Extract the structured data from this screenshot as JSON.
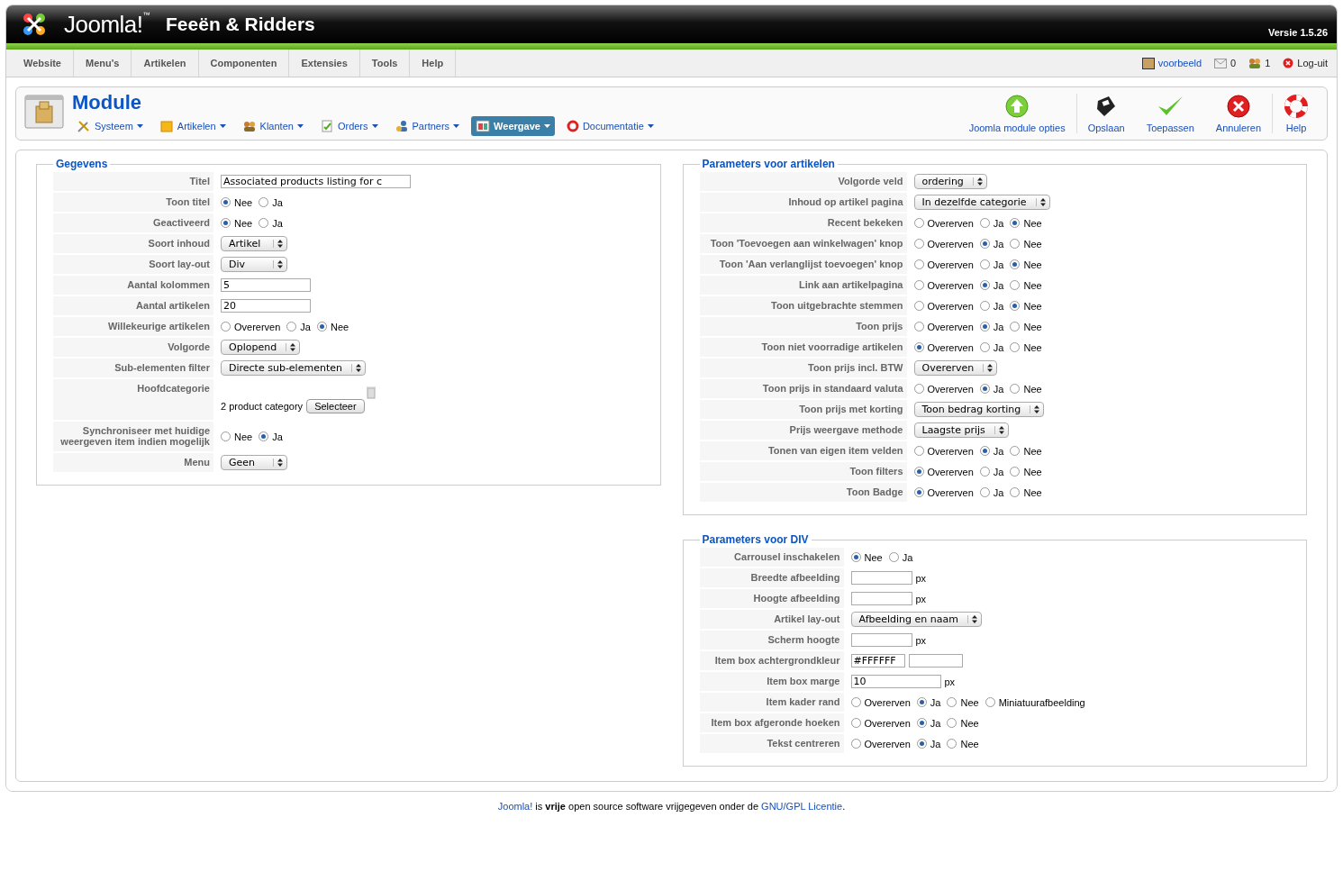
{
  "header": {
    "logo": "Joomla!$^{™}$",
    "site": "Feeën & Ridders",
    "version": "Versie 1.5.26"
  },
  "menu": [
    "Website",
    "Menu's",
    "Artikelen",
    "Componenten",
    "Extensies",
    "Tools",
    "Help"
  ],
  "status": [
    {
      "kind": "user",
      "label": "voorbeeld"
    },
    {
      "kind": "messages",
      "label": "0"
    },
    {
      "kind": "users",
      "label": "1"
    },
    {
      "kind": "logout",
      "label": "Log-uit"
    }
  ],
  "toolbar": {
    "title": "Module",
    "submenu": [
      {
        "label": "Systeem",
        "selected": false
      },
      {
        "label": "Artikelen",
        "selected": false
      },
      {
        "label": "Klanten",
        "selected": false
      },
      {
        "label": "Orders",
        "selected": false
      },
      {
        "label": "Partners",
        "selected": false
      },
      {
        "label": "Weergave",
        "selected": true
      },
      {
        "label": "Documentatie",
        "selected": false
      }
    ],
    "actions": [
      "Joomla module opties",
      "Opslaan",
      "Toepassen",
      "Annuleren",
      "Help"
    ]
  },
  "columns": [
    [
      {
        "title": "Gegevens",
        "rows": [
          {
            "kind": "text",
            "label": "Titel",
            "value": "Associated products listing for c"
          },
          {
            "kind": "radio",
            "label": "Toon titel",
            "options": [
              {
                "label": "Nee",
                "selected": true
              },
              {
                "label": "Ja",
                "selected": false
              }
            ]
          },
          {
            "kind": "radio",
            "label": "Geactiveerd",
            "options": [
              {
                "label": "Nee",
                "selected": true
              },
              {
                "label": "Ja",
                "selected": false
              }
            ]
          },
          {
            "kind": "select",
            "label": "Soort inhoud",
            "value": "Artikel"
          },
          {
            "kind": "select",
            "label": "Soort lay-out",
            "value": "Div"
          },
          {
            "kind": "text",
            "label": "Aantal kolommen",
            "value": "5"
          },
          {
            "kind": "text",
            "label": "Aantal artikelen",
            "value": "20"
          },
          {
            "kind": "radio",
            "label": "Willekeurige artikelen",
            "options": [
              {
                "label": "Overerven",
                "selected": false
              },
              {
                "label": "Ja",
                "selected": false
              },
              {
                "label": "Nee",
                "selected": true
              }
            ]
          },
          {
            "kind": "select",
            "label": "Volgorde",
            "value": "Oplopend"
          },
          {
            "kind": "select",
            "label": "Sub-elementen filter",
            "value": "Directe sub-elementen"
          },
          {
            "kind": "category",
            "label": "Hoofdcategorie",
            "value": "2 product category",
            "button": "Selecteer"
          },
          {
            "kind": "radio",
            "label": "Synchroniseer met huidige weergeven item indien mogelijk",
            "options": [
              {
                "label": "Nee",
                "selected": false
              },
              {
                "label": "Ja",
                "selected": true
              }
            ]
          },
          {
            "kind": "select",
            "label": "Menu",
            "value": "Geen"
          }
        ]
      }
    ],
    [
      {
        "title": "Parameters voor artikelen",
        "rows": [
          {
            "kind": "select",
            "label": "Volgorde veld",
            "value": "ordering"
          },
          {
            "kind": "select",
            "label": "Inhoud op artikel pagina",
            "value": "In dezelfde categorie"
          },
          {
            "kind": "radio",
            "label": "Recent bekeken",
            "options": [
              {
                "label": "Overerven",
                "selected": false
              },
              {
                "label": "Ja",
                "selected": false
              },
              {
                "label": "Nee",
                "selected": true
              }
            ]
          },
          {
            "kind": "radio",
            "label": "Toon 'Toevoegen aan winkelwagen' knop",
            "options": [
              {
                "label": "Overerven",
                "selected": false
              },
              {
                "label": "Ja",
                "selected": true
              },
              {
                "label": "Nee",
                "selected": false
              }
            ]
          },
          {
            "kind": "radio",
            "label": "Toon 'Aan verlanglijst toevoegen' knop",
            "options": [
              {
                "label": "Overerven",
                "selected": false
              },
              {
                "label": "Ja",
                "selected": false
              },
              {
                "label": "Nee",
                "selected": true
              }
            ]
          },
          {
            "kind": "radio",
            "label": "Link aan artikelpagina",
            "options": [
              {
                "label": "Overerven",
                "selected": false
              },
              {
                "label": "Ja",
                "selected": true
              },
              {
                "label": "Nee",
                "selected": false
              }
            ]
          },
          {
            "kind": "radio",
            "label": "Toon uitgebrachte stemmen",
            "options": [
              {
                "label": "Overerven",
                "selected": false
              },
              {
                "label": "Ja",
                "selected": false
              },
              {
                "label": "Nee",
                "selected": true
              }
            ]
          },
          {
            "kind": "radio",
            "label": "Toon prijs",
            "options": [
              {
                "label": "Overerven",
                "selected": false
              },
              {
                "label": "Ja",
                "selected": true
              },
              {
                "label": "Nee",
                "selected": false
              }
            ]
          },
          {
            "kind": "radio",
            "label": "Toon niet voorradige artikelen",
            "options": [
              {
                "label": "Overerven",
                "selected": true
              },
              {
                "label": "Ja",
                "selected": false
              },
              {
                "label": "Nee",
                "selected": false
              }
            ]
          },
          {
            "kind": "select",
            "label": "Toon prijs incl. BTW",
            "value": "Overerven"
          },
          {
            "kind": "radio",
            "label": "Toon prijs in standaard valuta",
            "options": [
              {
                "label": "Overerven",
                "selected": false
              },
              {
                "label": "Ja",
                "selected": true
              },
              {
                "label": "Nee",
                "selected": false
              }
            ]
          },
          {
            "kind": "select",
            "label": "Toon prijs met korting",
            "value": "Toon bedrag korting"
          },
          {
            "kind": "select",
            "label": "Prijs weergave methode",
            "value": "Laagste prijs"
          },
          {
            "kind": "radio",
            "label": "Tonen van eigen item velden",
            "options": [
              {
                "label": "Overerven",
                "selected": false
              },
              {
                "label": "Ja",
                "selected": true
              },
              {
                "label": "Nee",
                "selected": false
              }
            ]
          },
          {
            "kind": "radio",
            "label": "Toon filters",
            "options": [
              {
                "label": "Overerven",
                "selected": true
              },
              {
                "label": "Ja",
                "selected": false
              },
              {
                "label": "Nee",
                "selected": false
              }
            ]
          },
          {
            "kind": "radio",
            "label": "Toon Badge",
            "options": [
              {
                "label": "Overerven",
                "selected": true
              },
              {
                "label": "Ja",
                "selected": false
              },
              {
                "label": "Nee",
                "selected": false
              }
            ]
          }
        ]
      },
      {
        "title": "Parameters voor DIV",
        "rows": [
          {
            "kind": "radio",
            "label": "Carrousel inschakelen",
            "options": [
              {
                "label": "Nee",
                "selected": true
              },
              {
                "label": "Ja",
                "selected": false
              }
            ]
          },
          {
            "kind": "unit",
            "label": "Breedte afbeelding",
            "unit": "px"
          },
          {
            "kind": "unit",
            "label": "Hoogte afbeelding",
            "unit": "px"
          },
          {
            "kind": "select",
            "label": "Artikel lay-out",
            "value": "Afbeelding en naam"
          },
          {
            "kind": "unit",
            "label": "Scherm hoogte",
            "unit": "px"
          },
          {
            "kind": "color",
            "label": "Item box achtergrondkleur",
            "value": "#FFFFFF"
          },
          {
            "kind": "unit",
            "label": "Item box marge",
            "value": "10",
            "unit": "px"
          },
          {
            "kind": "radio",
            "label": "Item kader rand",
            "options": [
              {
                "label": "Overerven",
                "selected": false
              },
              {
                "label": "Ja",
                "selected": true
              },
              {
                "label": "Nee",
                "selected": false
              },
              {
                "label": "Miniatuurafbeelding",
                "selected": false
              }
            ]
          },
          {
            "kind": "radio",
            "label": "Item box afgeronde hoeken",
            "options": [
              {
                "label": "Overerven",
                "selected": false
              },
              {
                "label": "Ja",
                "selected": true
              },
              {
                "label": "Nee",
                "selected": false
              }
            ]
          },
          {
            "kind": "radio",
            "label": "Tekst centreren",
            "options": [
              {
                "label": "Overerven",
                "selected": false
              },
              {
                "label": "Ja",
                "selected": true
              },
              {
                "label": "Nee",
                "selected": false
              }
            ]
          }
        ]
      }
    ]
  ],
  "footer": {
    "link": "Joomla!",
    "text": " is **vrije** open source software vrijgegeven onder de ",
    "license": "GNU/GPL Licentie",
    "end": "."
  }
}
